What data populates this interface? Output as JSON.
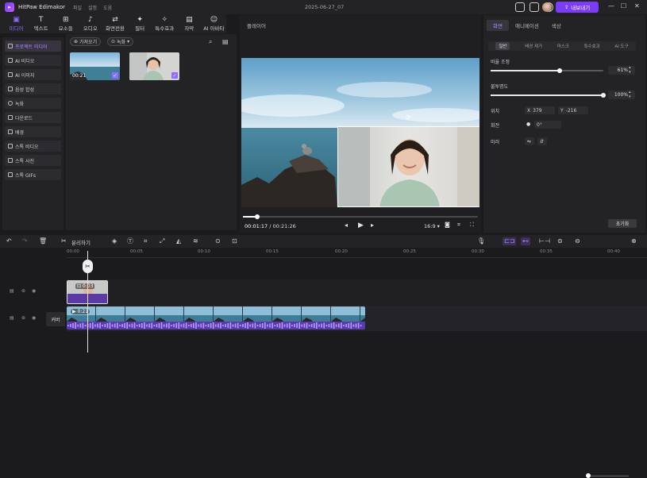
{
  "app": {
    "name": "HitPaw Edimakor",
    "menu": [
      "파일",
      "설정",
      "도움"
    ],
    "document_title": "2025-06-27_07",
    "export_label": "내보내기"
  },
  "media_tabs": [
    {
      "label": "미디어",
      "icon": "media-icon"
    },
    {
      "label": "텍스트",
      "icon": "text-icon"
    },
    {
      "label": "요소들",
      "icon": "elements-icon"
    },
    {
      "label": "오디오",
      "icon": "audio-icon"
    },
    {
      "label": "화면전환",
      "icon": "transition-icon"
    },
    {
      "label": "필터",
      "icon": "filter-icon"
    },
    {
      "label": "특수효과",
      "icon": "effects-icon"
    },
    {
      "label": "자막",
      "icon": "subtitle-icon"
    },
    {
      "label": "AI 아바타",
      "icon": "ai-avatar-icon"
    }
  ],
  "sidebar": {
    "items": [
      {
        "label": "프로젝트 미디어"
      },
      {
        "label": "AI 비디오"
      },
      {
        "label": "AI 이미지"
      },
      {
        "label": "음성 합성"
      },
      {
        "label": "녹화"
      },
      {
        "label": "다운로드"
      },
      {
        "label": "배경"
      },
      {
        "label": "스톡 비디오"
      },
      {
        "label": "스톡 사진"
      },
      {
        "label": "스톡 GIFs"
      }
    ]
  },
  "media": {
    "import_label": "가져오기",
    "record_label": "녹화",
    "clips": [
      {
        "duration": "00:21"
      },
      {
        "duration": ""
      }
    ]
  },
  "player": {
    "title": "플레이어",
    "current_time": "00:01:17",
    "total_time": "00:21:26",
    "aspect": "16:9",
    "progress": 0.06
  },
  "properties": {
    "tabs": [
      "화면",
      "애니메이션",
      "색상"
    ],
    "subtabs": [
      "일반",
      "배경 제거",
      "마스크",
      "특수효과",
      "AI 도구"
    ],
    "scale": {
      "label": "비율 조정",
      "value": "61%",
      "fraction": 0.61
    },
    "opacity": {
      "label": "불투명도",
      "value": "100%",
      "fraction": 1.0
    },
    "position": {
      "label": "위치",
      "x_label": "X",
      "x": "379",
      "y_label": "Y",
      "y": "-216"
    },
    "rotation": {
      "label": "회전",
      "value": "0°"
    },
    "mirror": {
      "label": "미러"
    },
    "reset_label": "초기화"
  },
  "timeline": {
    "split_label": "분리하기",
    "ruler": [
      "00:00",
      "00:05",
      "00:10",
      "00:15",
      "00:20",
      "00:25",
      "00:30",
      "00:35",
      "00:40"
    ],
    "top_clip": {
      "duration": "0:03"
    },
    "main_clip": {
      "duration": "0:21"
    },
    "cover_label": "커버"
  }
}
